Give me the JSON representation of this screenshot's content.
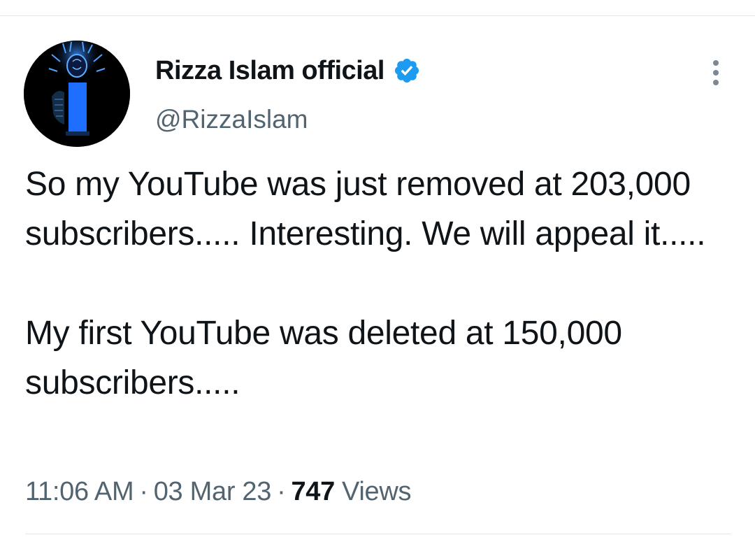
{
  "author": {
    "name": "Rizza Islam official",
    "handle": "@RizzaIslam",
    "verified": true,
    "verified_color": "#1d9bf0",
    "avatar_icon": "glowing-head-avatar"
  },
  "tweet": {
    "paragraphs": [
      "So my YouTube was just removed at 203,000 subscribers..... Interesting. We will appeal it.....",
      "My first YouTube was deleted at 150,000 subscribers....."
    ]
  },
  "meta": {
    "time": "11:06 AM",
    "date": "03 Mar 23",
    "separator": "·",
    "views_count": "747",
    "views_label": "Views"
  },
  "icons": {
    "more": "more-vertical-icon",
    "verified": "verified-badge-icon"
  }
}
